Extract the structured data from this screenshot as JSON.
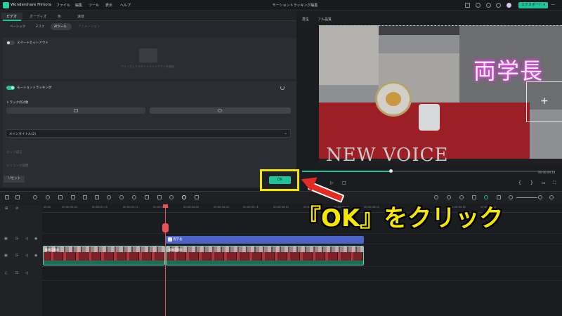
{
  "app": {
    "name": "Wondershare Filmora",
    "menu": [
      "ファイル",
      "編集",
      "ツール",
      "表示",
      "ヘルプ"
    ],
    "project_title": "モーショントラッキング編集",
    "export_label": "エクスポート"
  },
  "left_panel": {
    "tabs": [
      "ビデオ",
      "オーディオ",
      "色",
      "速度"
    ],
    "subtabs": [
      "ベーシック",
      "マスク",
      "AIツール",
      "アニメーション"
    ],
    "smart_cutout_label": "スマートカットアウト",
    "smart_cutout_hint": "クリックしてスマートカットアウトを開始",
    "motion_tracking_label": "モーショントラッキング",
    "tracking_object_label": "トラックの対象",
    "link_label": "リンク要素",
    "link_value": "メインタイトル(2)",
    "option1_label": "エッジ補正",
    "option2_label": "トリミング調整",
    "reset_label": "リセット",
    "ok_label": "OK"
  },
  "preview": {
    "labels": [
      "再生",
      "フル品質"
    ],
    "overlay_text": "両学長",
    "poster_text": "NEW VOICE",
    "timecode": "00:00:09:14",
    "progress": 0.35
  },
  "timeline": {
    "ruler": [
      "00:00",
      "00:00:00:20",
      "00:00:01:15",
      "00:00:02:10",
      "00:00:03:05",
      "00:00:04:00",
      "00:00:04:20",
      "00:00:05:15",
      "00:00:06:10",
      "00:00:07:05",
      "00:00:08:00",
      "00:00:08:20",
      "00:00:09:15",
      "00:00:10:10"
    ],
    "title_clip_label": "両学長",
    "video_clip_label_left": "編集用動画",
    "video_clip_label_right": "編集用動画"
  },
  "annotation": {
    "callout": "『OK』をクリック",
    "arrow_color": "#e32b23",
    "text_color": "#f6e700",
    "highlight_color": "#f2e600"
  },
  "colors": {
    "accent": "#1fc39a",
    "playhead": "#e8525a",
    "title_clip": "#4c62c7"
  }
}
